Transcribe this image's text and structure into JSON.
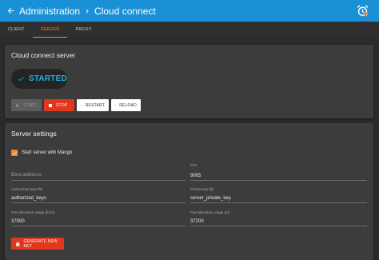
{
  "breadcrumb": {
    "root": "Administration",
    "current": "Cloud connect"
  },
  "tabs": [
    {
      "label": "CLIENT"
    },
    {
      "label": "SERVER",
      "active": true
    },
    {
      "label": "PROXY"
    }
  ],
  "server_card": {
    "title": "Cloud connect server",
    "status": "STARTED",
    "buttons": {
      "start": "START",
      "stop": "STOP",
      "restart": "RESTART",
      "reload": "RELOAD"
    }
  },
  "settings_card": {
    "title": "Server settings",
    "mango_checkbox": {
      "label": "Start server with Mango",
      "checked": true
    },
    "bind_address": {
      "placeholder": "Bind address",
      "value": ""
    },
    "port": {
      "label": "Port",
      "value": "9005"
    },
    "authorized_keys": {
      "label": "Authorized keys file",
      "value": "authorized_keys"
    },
    "private_key": {
      "label": "Private key file",
      "value": "server_private_key"
    },
    "port_from": {
      "label": "Port allocation range (from)",
      "value": "37000"
    },
    "port_to": {
      "label": "Port allocation range (to)",
      "value": "37200"
    },
    "generate_button": "GENERATE NEW KEY"
  },
  "colors": {
    "app_bar": "#1a90d6",
    "accent": "#f08a33",
    "status": "#20b2e6",
    "danger": "#e2361e"
  },
  "icons": [
    "arrow-back-icon",
    "chevron-right-icon",
    "alarm-clock-icon",
    "checkmark-icon",
    "play-icon",
    "stop-icon",
    "refresh-icon",
    "lock-icon"
  ]
}
